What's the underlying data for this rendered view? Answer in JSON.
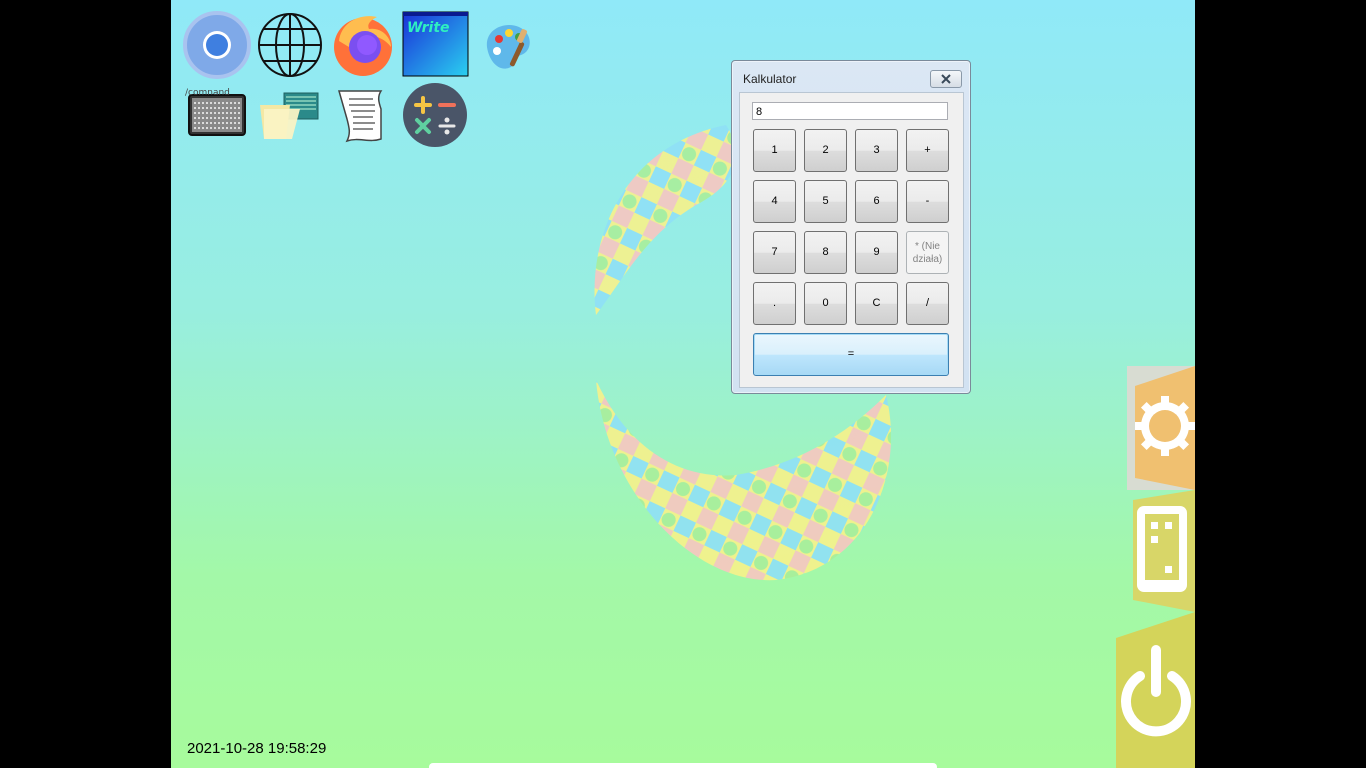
{
  "desktop": {
    "icons": [
      {
        "name": "chromium-icon"
      },
      {
        "name": "web-browser-globe-icon"
      },
      {
        "name": "firefox-icon"
      },
      {
        "name": "write-icon",
        "label": "Write"
      },
      {
        "name": "paint-icon"
      },
      {
        "name": "terminal-icon",
        "caption": "/comnand"
      },
      {
        "name": "file-manager-icon"
      },
      {
        "name": "text-document-icon"
      },
      {
        "name": "calculator-icon"
      }
    ],
    "clock": "2021-10-28 19:58:29"
  },
  "calculator": {
    "title": "Kalkulator",
    "display_value": "8",
    "buttons": {
      "b1": "1",
      "b2": "2",
      "b3": "3",
      "plus": "+",
      "b4": "4",
      "b5": "5",
      "b6": "6",
      "minus": "-",
      "b7": "7",
      "b8": "8",
      "b9": "9",
      "multiply": "* (Nie działa)",
      "dot": ".",
      "b0": "0",
      "clear": "C",
      "divide": "/",
      "equals": "="
    }
  },
  "side_panel": {
    "items": [
      {
        "name": "settings-gear-icon",
        "color": "#f0c070"
      },
      {
        "name": "devices-icon",
        "color": "#d8d668"
      },
      {
        "name": "power-icon",
        "color": "#d4d45a"
      }
    ]
  },
  "colors": {
    "desktop_top": "#90e9f8",
    "desktop_bottom": "#a7fb9c",
    "equals_button_border": "#3c7fb1"
  }
}
